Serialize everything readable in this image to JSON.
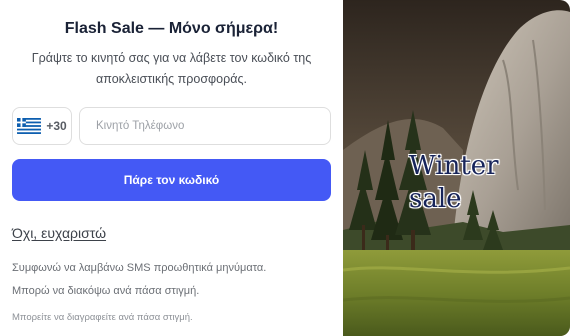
{
  "modal": {
    "title": "Flash Sale — Μόνο σήμερα!",
    "subtitle": "Γράψτε το κινητό σας για να λάβετε τον κωδικό της αποκλειστικής προσφοράς."
  },
  "form": {
    "country_code": "+30",
    "country_flag": "greece-flag-icon",
    "phone_placeholder": "Κινητό Τηλέφωνο",
    "phone_value": "",
    "submit_label": "Πάρε τον κωδικό",
    "decline_label": "Όχι, ευχαριστώ"
  },
  "legal": {
    "consent_line1": "Συμφωνώ να λαμβάνω SMS προωθητικά μηνύματα.",
    "consent_line2": "Μπορώ να διακόψω ανά πάσα στιγμή.",
    "unsubscribe": "Μπορείτε να διαγραφείτε ανά πάσα στιγμή."
  },
  "hero": {
    "line1": "Winter",
    "line2": "sale",
    "image": "mountain-valley-forest-photo"
  },
  "colors": {
    "accent": "#4459f5",
    "title": "#1a2236",
    "hero_text": "#17245a"
  }
}
